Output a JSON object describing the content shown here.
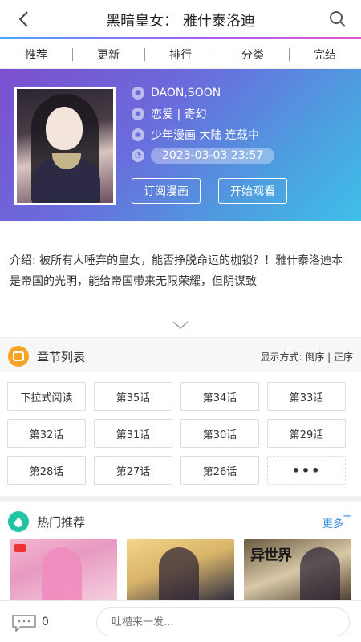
{
  "header": {
    "title": "黑暗皇女：  雅什泰洛迪",
    "back_icon": "chevron-left-icon",
    "search_icon": "search-icon",
    "accent_gradient": [
      "#4aa8ff",
      "#a85cf0",
      "#e05ad0"
    ]
  },
  "nav": {
    "items": [
      {
        "label": "推荐"
      },
      {
        "label": "更新"
      },
      {
        "label": "排行"
      },
      {
        "label": "分类"
      },
      {
        "label": "完结"
      }
    ]
  },
  "comic": {
    "author": "DAON,SOON",
    "genre": "恋爱 | 奇幻",
    "tags": "少年漫画 大陆 连载中",
    "updated": "2023-03-03 23:57",
    "subscribe_label": "订阅漫画",
    "start_label": "开始观看",
    "hero_gradient": [
      "#7c4fd0",
      "#4ca0e0",
      "#3ec0e8"
    ]
  },
  "description": "介绍: 被所有人唾弃的皇女，能否挣脱命运的枷锁？！雅什泰洛迪本是帝国的光明，能给帝国带来无限荣耀，但阴谋致",
  "chapters": {
    "title": "章节列表",
    "order_label": "显示方式: 倒序 | 正序",
    "items": [
      {
        "label": "下拉式阅读"
      },
      {
        "label": "第35话"
      },
      {
        "label": "第34话"
      },
      {
        "label": "第33话"
      },
      {
        "label": "第32话"
      },
      {
        "label": "第31话"
      },
      {
        "label": "第30话"
      },
      {
        "label": "第29话"
      },
      {
        "label": "第28话"
      },
      {
        "label": "第27话"
      },
      {
        "label": "第26话"
      }
    ],
    "more_label": "•••",
    "accent": "#f7a325"
  },
  "hot": {
    "title": "热门推荐",
    "more_label": "更多",
    "more_plus": "+",
    "accent": "#22c3a3",
    "thumb3_text": "异世界"
  },
  "bottom": {
    "comment_count": "0",
    "input_placeholder": "吐槽来一发..."
  }
}
